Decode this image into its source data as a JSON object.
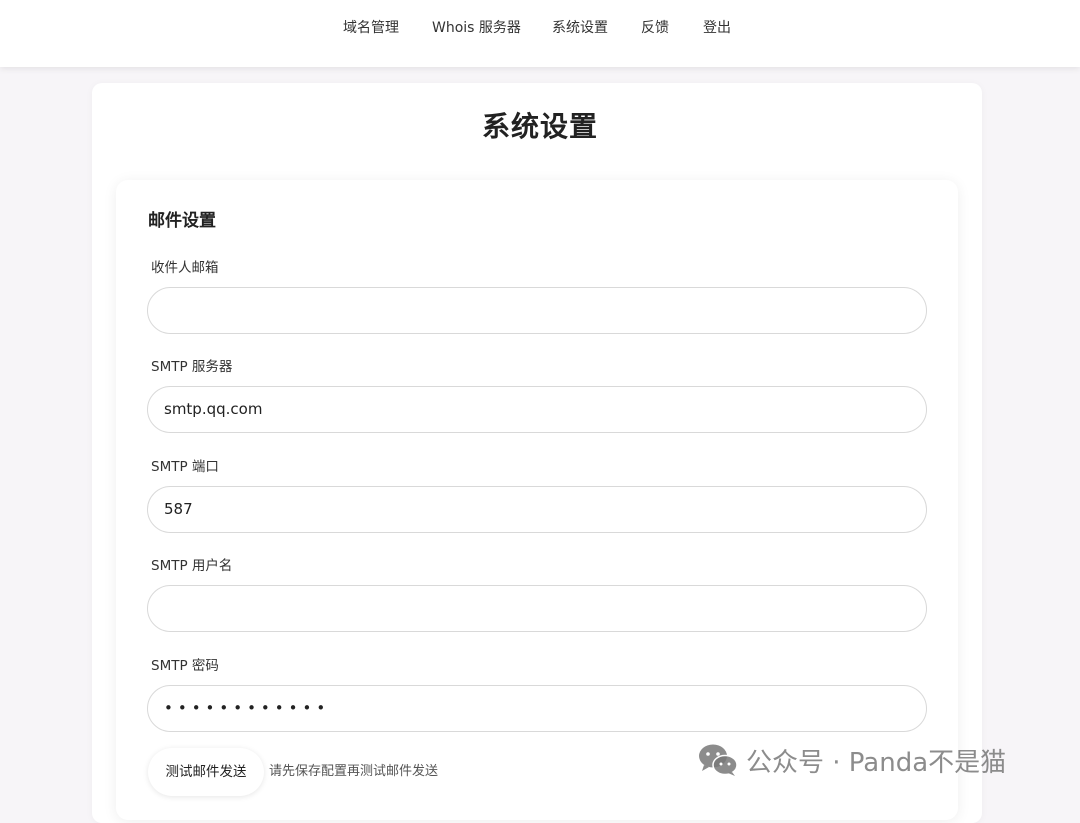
{
  "nav": {
    "items": [
      {
        "label": "域名管理"
      },
      {
        "label": "Whois 服务器"
      },
      {
        "label": "系统设置"
      },
      {
        "label": "反馈"
      },
      {
        "label": "登出"
      }
    ]
  },
  "page": {
    "title": "系统设置"
  },
  "email_settings": {
    "section_title": "邮件设置",
    "fields": [
      {
        "label": "收件人邮箱",
        "value": ""
      },
      {
        "label": "SMTP 服务器",
        "value": "smtp.qq.com"
      },
      {
        "label": "SMTP 端口",
        "value": "587"
      },
      {
        "label": "SMTP 用户名",
        "value": ""
      },
      {
        "label": "SMTP 密码",
        "value": "••••••••••••"
      }
    ],
    "test_button_label": "测试邮件发送",
    "hint": "请先保存配置再测试邮件发送"
  },
  "watermark": {
    "text": "公众号 · Panda不是猫",
    "icon": "wechat-icon"
  }
}
